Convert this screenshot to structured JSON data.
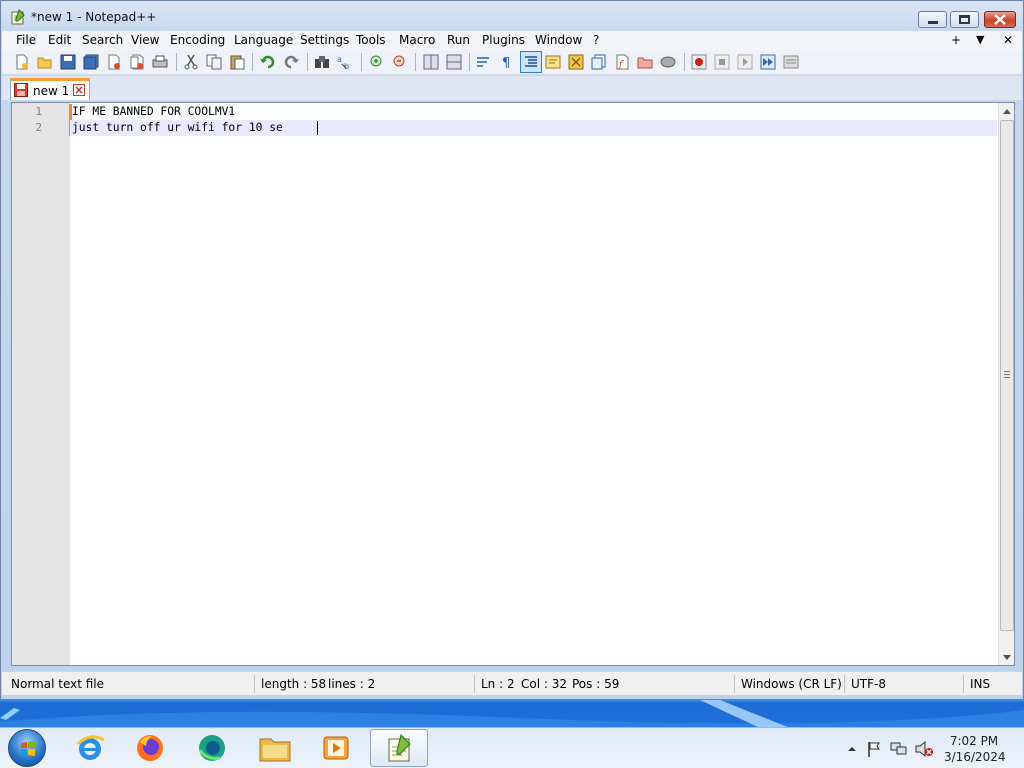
{
  "window": {
    "title": "*new 1 - Notepad++",
    "icons": {
      "app": "notepad-plus-plus-icon",
      "minimize": "minimize-icon",
      "maximize": "maximize-icon",
      "close": "close-icon"
    }
  },
  "menubar": {
    "items": [
      "File",
      "Edit",
      "Search",
      "View",
      "Encoding",
      "Language",
      "Settings",
      "Tools",
      "Macro",
      "Run",
      "Plugins",
      "Window",
      "?"
    ],
    "right": {
      "add": "+",
      "dropdown": "▼",
      "close": "✕"
    }
  },
  "toolbar": {
    "icons": [
      "new-file-icon",
      "open-file-icon",
      "save-icon",
      "save-all-icon",
      "close-icon",
      "close-all-icon",
      "print-icon",
      "cut-icon",
      "copy-icon",
      "paste-icon",
      "undo-icon",
      "redo-icon",
      "find-icon",
      "replace-icon",
      "zoom-in-icon",
      "zoom-out-icon",
      "sync-vertical-icon",
      "sync-horizontal-icon",
      "word-wrap-icon",
      "show-all-characters-icon",
      "indent-guide-icon",
      "user-language-icon",
      "document-map-icon",
      "document-list-icon",
      "function-list-icon",
      "folder-workspace-icon",
      "monitoring-icon",
      "record-macro-icon",
      "stop-macro-icon",
      "play-macro-icon",
      "run-macro-multiple-icon",
      "save-macro-icon"
    ]
  },
  "tabs": [
    {
      "label": "new 1",
      "modified": true,
      "active": true
    }
  ],
  "editor": {
    "line_numbers": [
      "1",
      "2"
    ],
    "lines": [
      "IF ME BANNED FOR COOLMV1",
      "just turn off ur wifi for 10 se"
    ],
    "current_line": 2
  },
  "statusbar": {
    "file_type": "Normal text file",
    "length": "length : 58",
    "lines": "lines : 2",
    "ln": "Ln : 2",
    "col": "Col : 32",
    "pos": "Pos : 59",
    "eol": "Windows (CR LF)",
    "encoding": "UTF-8",
    "mode": "INS"
  },
  "taskbar": {
    "apps": [
      "internet-explorer-icon",
      "firefox-icon",
      "edge-icon",
      "file-explorer-icon",
      "media-player-icon",
      "notepad-plus-plus-icon"
    ],
    "tray": [
      "show-hidden-icons-icon",
      "action-center-flag-icon",
      "network-icon",
      "volume-muted-icon"
    ],
    "time": "7:02 PM",
    "date": "3/16/2024"
  },
  "colors": {
    "accent_tab": "#f59d3b",
    "current_line_bg": "#e8e8ff",
    "gutter_bg": "#e4e4e4",
    "change_marker": "#f68a1e"
  }
}
